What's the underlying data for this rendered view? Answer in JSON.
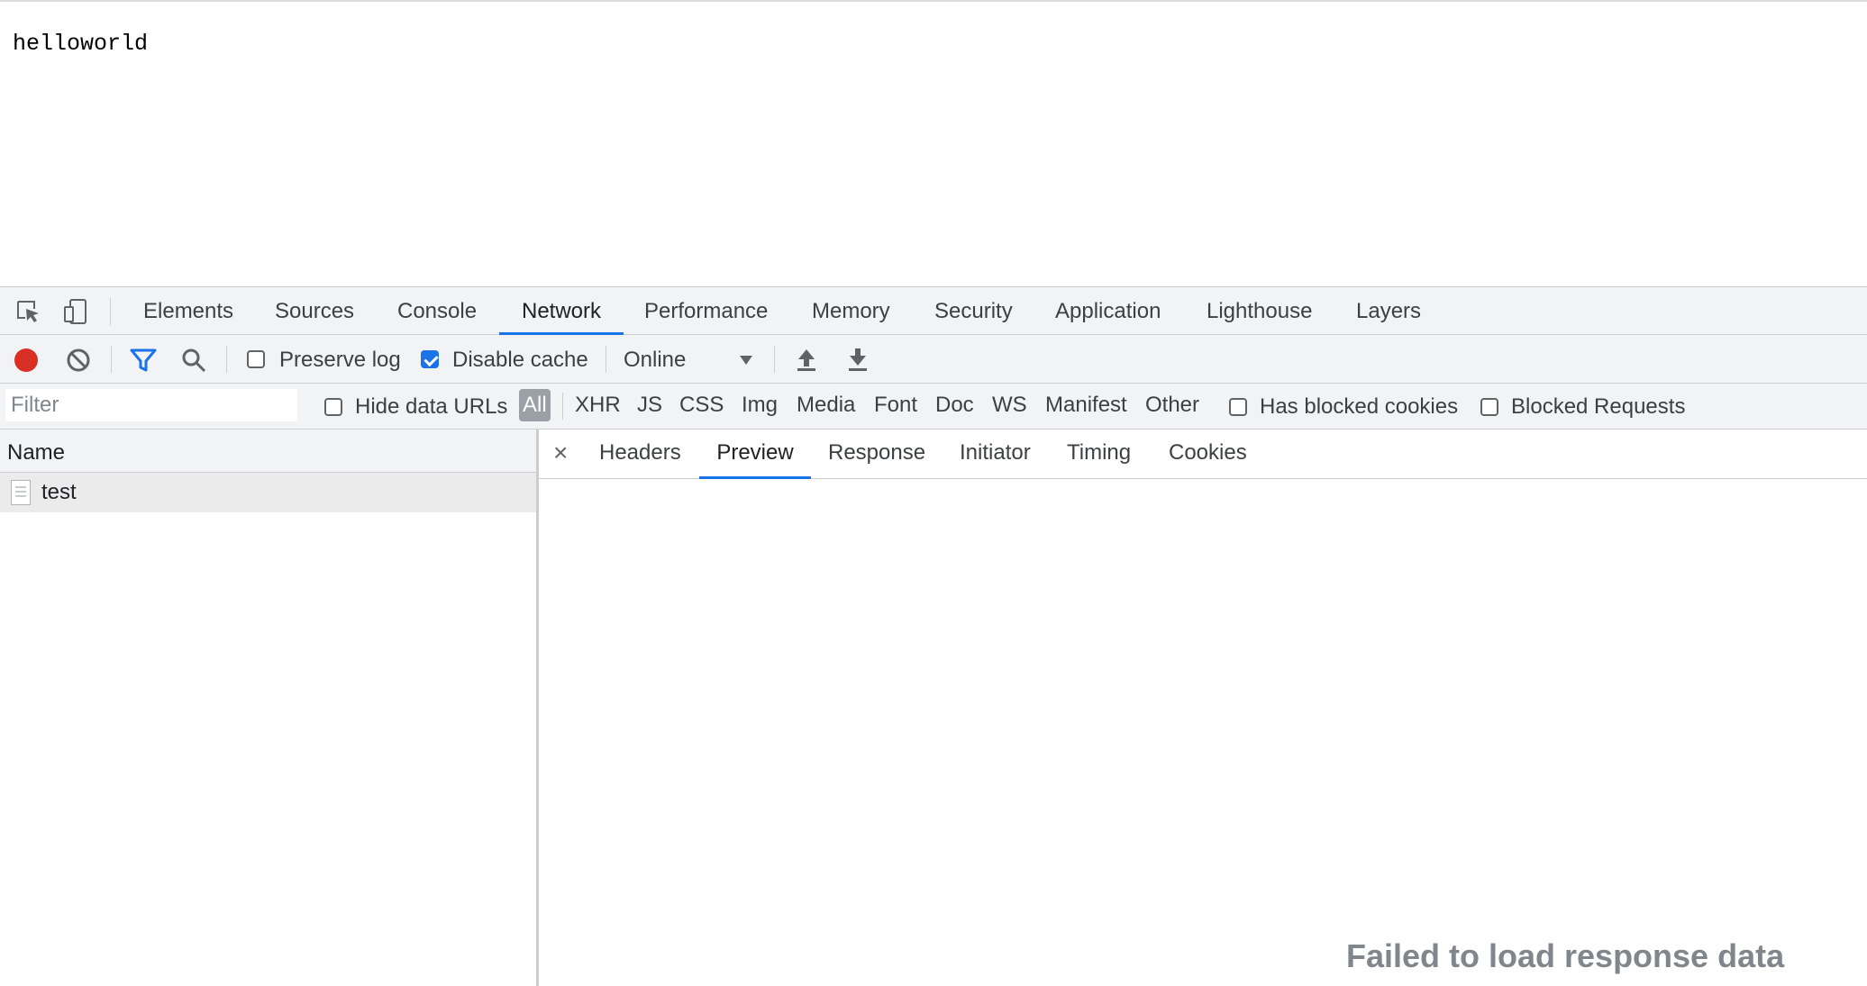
{
  "page": {
    "text": "helloworld"
  },
  "devtools": {
    "main_tabs": [
      "Elements",
      "Sources",
      "Console",
      "Network",
      "Performance",
      "Memory",
      "Security",
      "Application",
      "Lighthouse",
      "Layers"
    ],
    "active_main_tab": "Network",
    "toolbar": {
      "preserve_log": {
        "label": "Preserve log",
        "checked": false
      },
      "disable_cache": {
        "label": "Disable cache",
        "checked": true
      },
      "throttling": "Online"
    },
    "filter_bar": {
      "filter_placeholder": "Filter",
      "hide_data_urls": {
        "label": "Hide data URLs",
        "checked": false
      },
      "types": [
        "All",
        "XHR",
        "JS",
        "CSS",
        "Img",
        "Media",
        "Font",
        "Doc",
        "WS",
        "Manifest",
        "Other"
      ],
      "active_type": "All",
      "has_blocked_cookies": {
        "label": "Has blocked cookies",
        "checked": false
      },
      "blocked_requests": {
        "label": "Blocked Requests",
        "checked": false
      }
    },
    "request_list": {
      "column_header": "Name",
      "requests": [
        {
          "name": "test"
        }
      ]
    },
    "detail": {
      "close_symbol": "×",
      "tabs": [
        "Headers",
        "Preview",
        "Response",
        "Initiator",
        "Timing",
        "Cookies"
      ],
      "active_tab": "Preview",
      "message": "Failed to load response data"
    }
  },
  "colors": {
    "accent": "#1a73e8",
    "record": "#d93025",
    "toolbar_bg": "#f1f3f4",
    "border": "#cbcdd1"
  },
  "icons": [
    "inspect-element-icon",
    "device-toolbar-icon",
    "record-icon",
    "clear-icon",
    "filter-icon",
    "search-icon",
    "dropdown-arrow-icon",
    "import-har-icon",
    "export-har-icon",
    "file-icon",
    "close-icon"
  ]
}
